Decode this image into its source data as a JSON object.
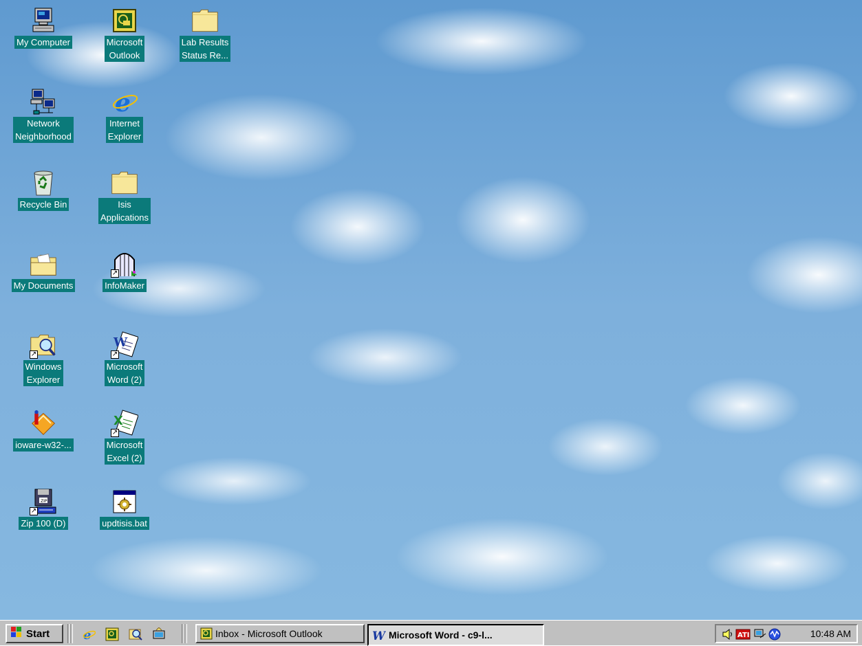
{
  "desktop": {
    "icons": [
      {
        "label": "My Computer",
        "icon": "computer-icon",
        "shortcut": false
      },
      {
        "label": "Microsoft\nOutlook",
        "icon": "outlook-icon",
        "shortcut": false
      },
      {
        "label": "Lab Results\nStatus Re...",
        "icon": "folder-icon",
        "shortcut": false
      },
      {
        "label": "Network\nNeighborhood",
        "icon": "network-icon",
        "shortcut": false
      },
      {
        "label": "Internet\nExplorer",
        "icon": "ie-icon",
        "shortcut": false
      },
      {
        "label": "Recycle Bin",
        "icon": "recycle-bin-icon",
        "shortcut": false
      },
      {
        "label": "Isis\nApplications",
        "icon": "folder-icon",
        "shortcut": false
      },
      {
        "label": "My Documents",
        "icon": "documents-folder-icon",
        "shortcut": false
      },
      {
        "label": "InfoMaker",
        "icon": "infomaker-icon",
        "shortcut": true
      },
      {
        "label": "Windows\nExplorer",
        "icon": "explorer-icon",
        "shortcut": true
      },
      {
        "label": "Microsoft\nWord (2)",
        "icon": "word-icon",
        "shortcut": true
      },
      {
        "label": "ioware-w32-...",
        "icon": "ioware-icon",
        "shortcut": false
      },
      {
        "label": "Microsoft\nExcel (2)",
        "icon": "excel-icon",
        "shortcut": true
      },
      {
        "label": "Zip 100 (D)",
        "icon": "zip-drive-icon",
        "shortcut": true
      },
      {
        "label": "updtisis.bat",
        "icon": "batch-file-icon",
        "shortcut": false
      }
    ]
  },
  "taskbar": {
    "start_label": "Start",
    "quick_launch": [
      "ie-icon",
      "outlook-express-icon",
      "search-icon",
      "desktop-icon"
    ],
    "tasks": [
      {
        "label": "Inbox - Microsoft Outlook",
        "icon": "outlook-icon",
        "active": false
      },
      {
        "label": "Microsoft Word - c9-l...",
        "icon": "word-icon",
        "active": true
      }
    ],
    "tray": {
      "icons": [
        "speaker-icon",
        "ati-icon",
        "network-monitor-icon",
        "realplayer-icon"
      ],
      "clock": "10:48 AM"
    }
  },
  "colors": {
    "label_bg": "#0b7a7a",
    "taskbar": "#c0c0c0"
  }
}
